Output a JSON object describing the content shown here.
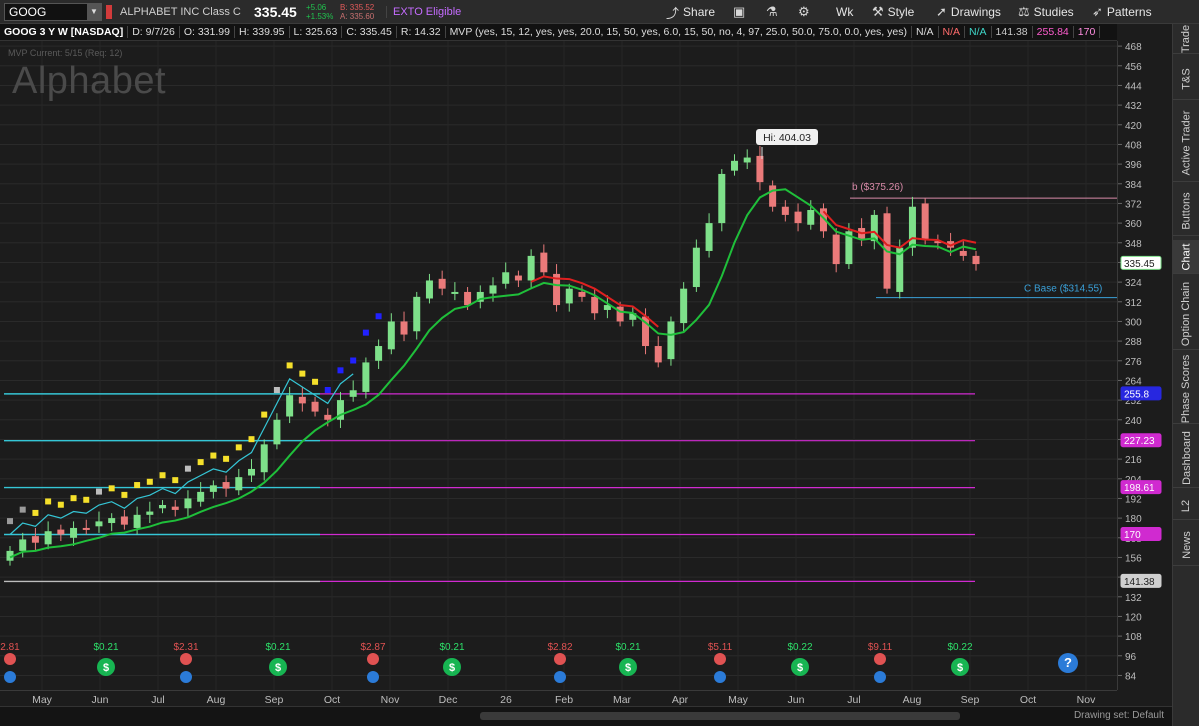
{
  "toolbar": {
    "symbol": "GOOG",
    "company": "ALPHABET INC Class C",
    "last_price": "335.45",
    "change": "+5.06",
    "change_pct": "+1.53%",
    "bid": "B: 335.52",
    "ask": "A: 335.60",
    "exto": "EXTO Eligible",
    "share": "Share",
    "period": "Wk",
    "style": "Style",
    "drawings": "Drawings",
    "studies": "Studies",
    "patterns": "Patterns"
  },
  "header": {
    "title": "GOOG 3 Y W [NASDAQ]",
    "date": "D: 9/7/26",
    "open": "O: 331.99",
    "high": "H: 339.95",
    "low": "L: 325.63",
    "close": "C: 335.45",
    "range": "R: 14.32",
    "study": "MVP (yes, 15, 12, yes, yes, 20.0, 15, 50, yes, 6.0, 15, 50, no, 4, 97, 25.0, 50.0, 75.0, 0.0, yes, yes)",
    "na1": "N/A",
    "na2": "N/A",
    "na3": "N/A",
    "v1": "141.38",
    "v2": "255.84",
    "v3": "170"
  },
  "overlay": {
    "mvp_current": "MVP Current: 5/15 (Req: 12)",
    "watermark": "Alphabet",
    "hi_label": "Hi: 404.03",
    "b_label": "b ($375.26)",
    "c_base_label": "C Base ($314.55)"
  },
  "colors": {
    "up": "#7ee08a",
    "down": "#ea7a7a",
    "green_ma": "#1fbf3a",
    "red_ma": "#e02020",
    "cyan": "#35c6d6",
    "magenta": "#d02ad0"
  },
  "chart_data": {
    "type": "candlestick",
    "y_range": [
      80,
      476
    ],
    "y_ticks": [
      "468",
      "456",
      "444",
      "432",
      "420",
      "408",
      "396",
      "384",
      "372",
      "360",
      "348",
      "336",
      "324",
      "312",
      "300",
      "288",
      "276",
      "264",
      "252",
      "240",
      "228",
      "216",
      "204",
      "192",
      "180",
      "168",
      "156",
      "144",
      "132",
      "120",
      "108",
      "96",
      "84"
    ],
    "x_labels": [
      "May",
      "Jun",
      "Jul",
      "Aug",
      "Sep",
      "Oct",
      "Nov",
      "Dec",
      "26",
      "Feb",
      "Mar",
      "Apr",
      "May",
      "Jun",
      "Jul",
      "Aug",
      "Sep",
      "Oct",
      "Nov"
    ],
    "price_markers": [
      {
        "label": "335.45",
        "value": 335.45,
        "bg": "#ffffff",
        "fg": "#1c1c1c",
        "border": "#7ee08a"
      },
      {
        "label": "255.8",
        "value": 255.8,
        "bg": "#2727e0",
        "fg": "#ffffff"
      },
      {
        "label": "227.23",
        "value": 227.23,
        "bg": "#d02ad0",
        "fg": "#ffffff"
      },
      {
        "label": "198.61",
        "value": 198.61,
        "bg": "#d02ad0",
        "fg": "#ffffff"
      },
      {
        "label": "170",
        "value": 170,
        "bg": "#d02ad0",
        "fg": "#ffffff"
      },
      {
        "label": "141.38",
        "value": 141.38,
        "bg": "#cfcfcf",
        "fg": "#1c1c1c"
      }
    ],
    "events": [
      {
        "label": "2.81",
        "kind": "earn"
      },
      {
        "label": "$0.21",
        "kind": "div"
      },
      {
        "label": "$2.31",
        "kind": "earn"
      },
      {
        "label": "$0.21",
        "kind": "div"
      },
      {
        "label": "$2.87",
        "kind": "earn"
      },
      {
        "label": "$0.21",
        "kind": "div"
      },
      {
        "label": "$2.82",
        "kind": "earn"
      },
      {
        "label": "$0.21",
        "kind": "div"
      },
      {
        "label": "$5.11",
        "kind": "earn"
      },
      {
        "label": "$0.22",
        "kind": "div"
      },
      {
        "label": "$9.11",
        "kind": "earn"
      },
      {
        "label": "$0.22",
        "kind": "div"
      }
    ],
    "hi": 404.03,
    "b_level": 375.26,
    "c_base": 314.55,
    "weekly_close_path": [
      160,
      167,
      165,
      172,
      170,
      174,
      173,
      178,
      180,
      176,
      182,
      184,
      188,
      185,
      192,
      196,
      200,
      198,
      205,
      210,
      225,
      240,
      255,
      250,
      245,
      240,
      252,
      258,
      275,
      285,
      300,
      292,
      315,
      325,
      320,
      318,
      310,
      318,
      322,
      330,
      325,
      340,
      330,
      310,
      320,
      315,
      305,
      310,
      300,
      305,
      285,
      275,
      300,
      320,
      345,
      360,
      390,
      398,
      400,
      385,
      370,
      365,
      360,
      368,
      355,
      335,
      355,
      350,
      365,
      320,
      345,
      370,
      350,
      348,
      345,
      340,
      335
    ]
  },
  "side_tabs": [
    "Trade",
    "T&S",
    "Active Trader",
    "Buttons",
    "Chart",
    "Option Chain",
    "Phase Scores",
    "Dashboard",
    "L2",
    "News"
  ],
  "footer": {
    "drawing_set": "Drawing set: Default"
  }
}
